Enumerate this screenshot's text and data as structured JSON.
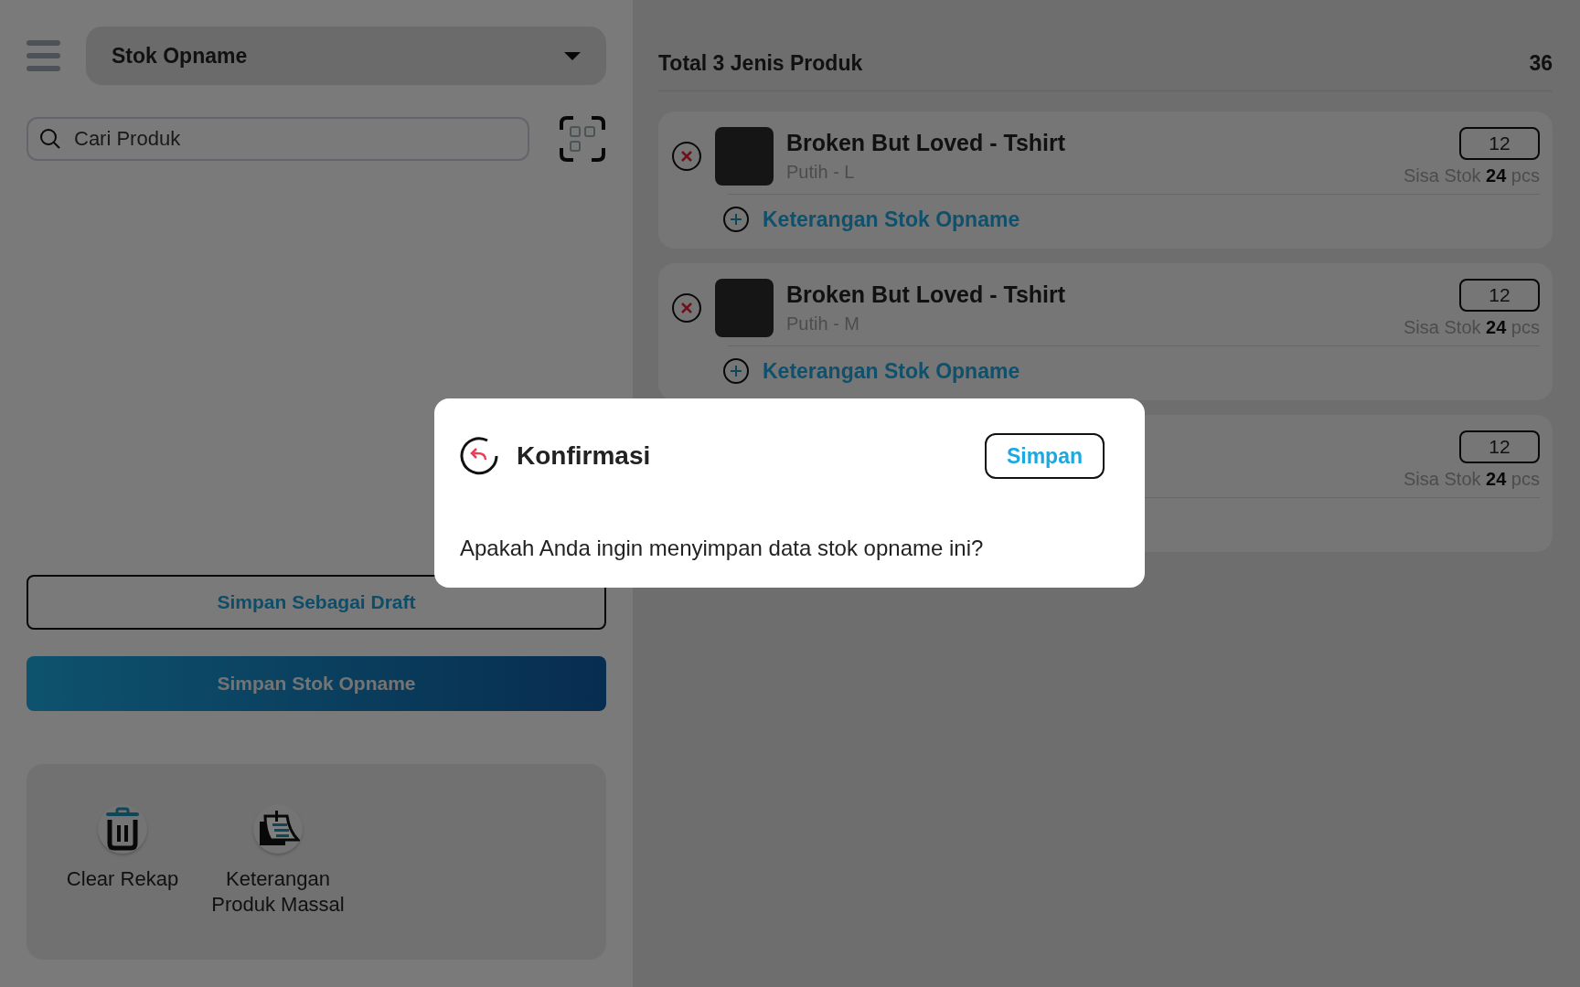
{
  "menu_dropdown": {
    "value": "Stok Opname"
  },
  "search": {
    "placeholder": "Cari Produk"
  },
  "buttons": [
    {
      "label": "Simpan Sebagai Draft",
      "kind": "outline"
    },
    {
      "label": "Simpan Stok Opname",
      "kind": "primary"
    }
  ],
  "actions": [
    {
      "label": "Clear Rekap",
      "kind": "trash"
    },
    {
      "label": "Keterangan Produk Massal",
      "kind": "note"
    }
  ],
  "summary": {
    "label": "Total 3 Jenis Produk",
    "total": "36"
  },
  "products": [
    {
      "name": "Broken But Loved - Tshirt",
      "variant": "Putih - L",
      "quantity": "12",
      "stock": "Sisa Stok **24** pcs",
      "note_link": "Keterangan Stok Opname"
    },
    {
      "name": "Broken But Loved - Tshirt",
      "variant": "Putih - M",
      "quantity": "12",
      "stock": "Sisa Stok **24** pcs",
      "note_link": "Keterangan Stok Opname"
    },
    {
      "quantity": "12",
      "stock": "Sisa Stok **24** pcs"
    }
  ],
  "dialog": {
    "title": "Konfirmasi",
    "confirm_button": "Simpan",
    "message": "Apakah Anda ingin menyimpan data stok opname ini?"
  }
}
